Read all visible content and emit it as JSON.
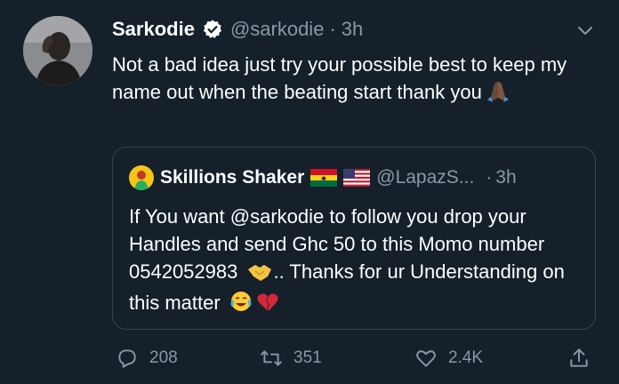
{
  "tweet": {
    "display_name": "Sarkodie",
    "handle": "@sarkodie",
    "separator": "·",
    "time": "3h",
    "text": "Not a bad idea just try your possible best to keep my name out when the beating start thank you",
    "text_emoji": "folded-hands-emoji"
  },
  "quoted_tweet": {
    "display_name": "Skillions Shaker",
    "flags": [
      "ghana-flag",
      "usa-flag"
    ],
    "handle": "@LapazS...",
    "separator": "·",
    "time": "3h",
    "text_before_emoji": "If You want @sarkodie to follow you drop your Handles and send Ghc 50 to this Momo number 0542052983",
    "text_after_emoji": ".. Thanks for ur Understanding on this matter",
    "emojis": [
      "handshake-emoji",
      "tears-of-joy-emoji",
      "broken-heart-emoji"
    ]
  },
  "actions": {
    "reply_count": "208",
    "retweet_count": "351",
    "like_count": "2.4K"
  },
  "colors": {
    "background": "#15202b",
    "secondary_text": "#8899a6",
    "border": "#38444d",
    "verified_blue": "#ffffff"
  },
  "icons": [
    "verified-badge-icon",
    "chevron-down-icon",
    "reply-icon",
    "retweet-icon",
    "like-icon",
    "share-icon"
  ]
}
